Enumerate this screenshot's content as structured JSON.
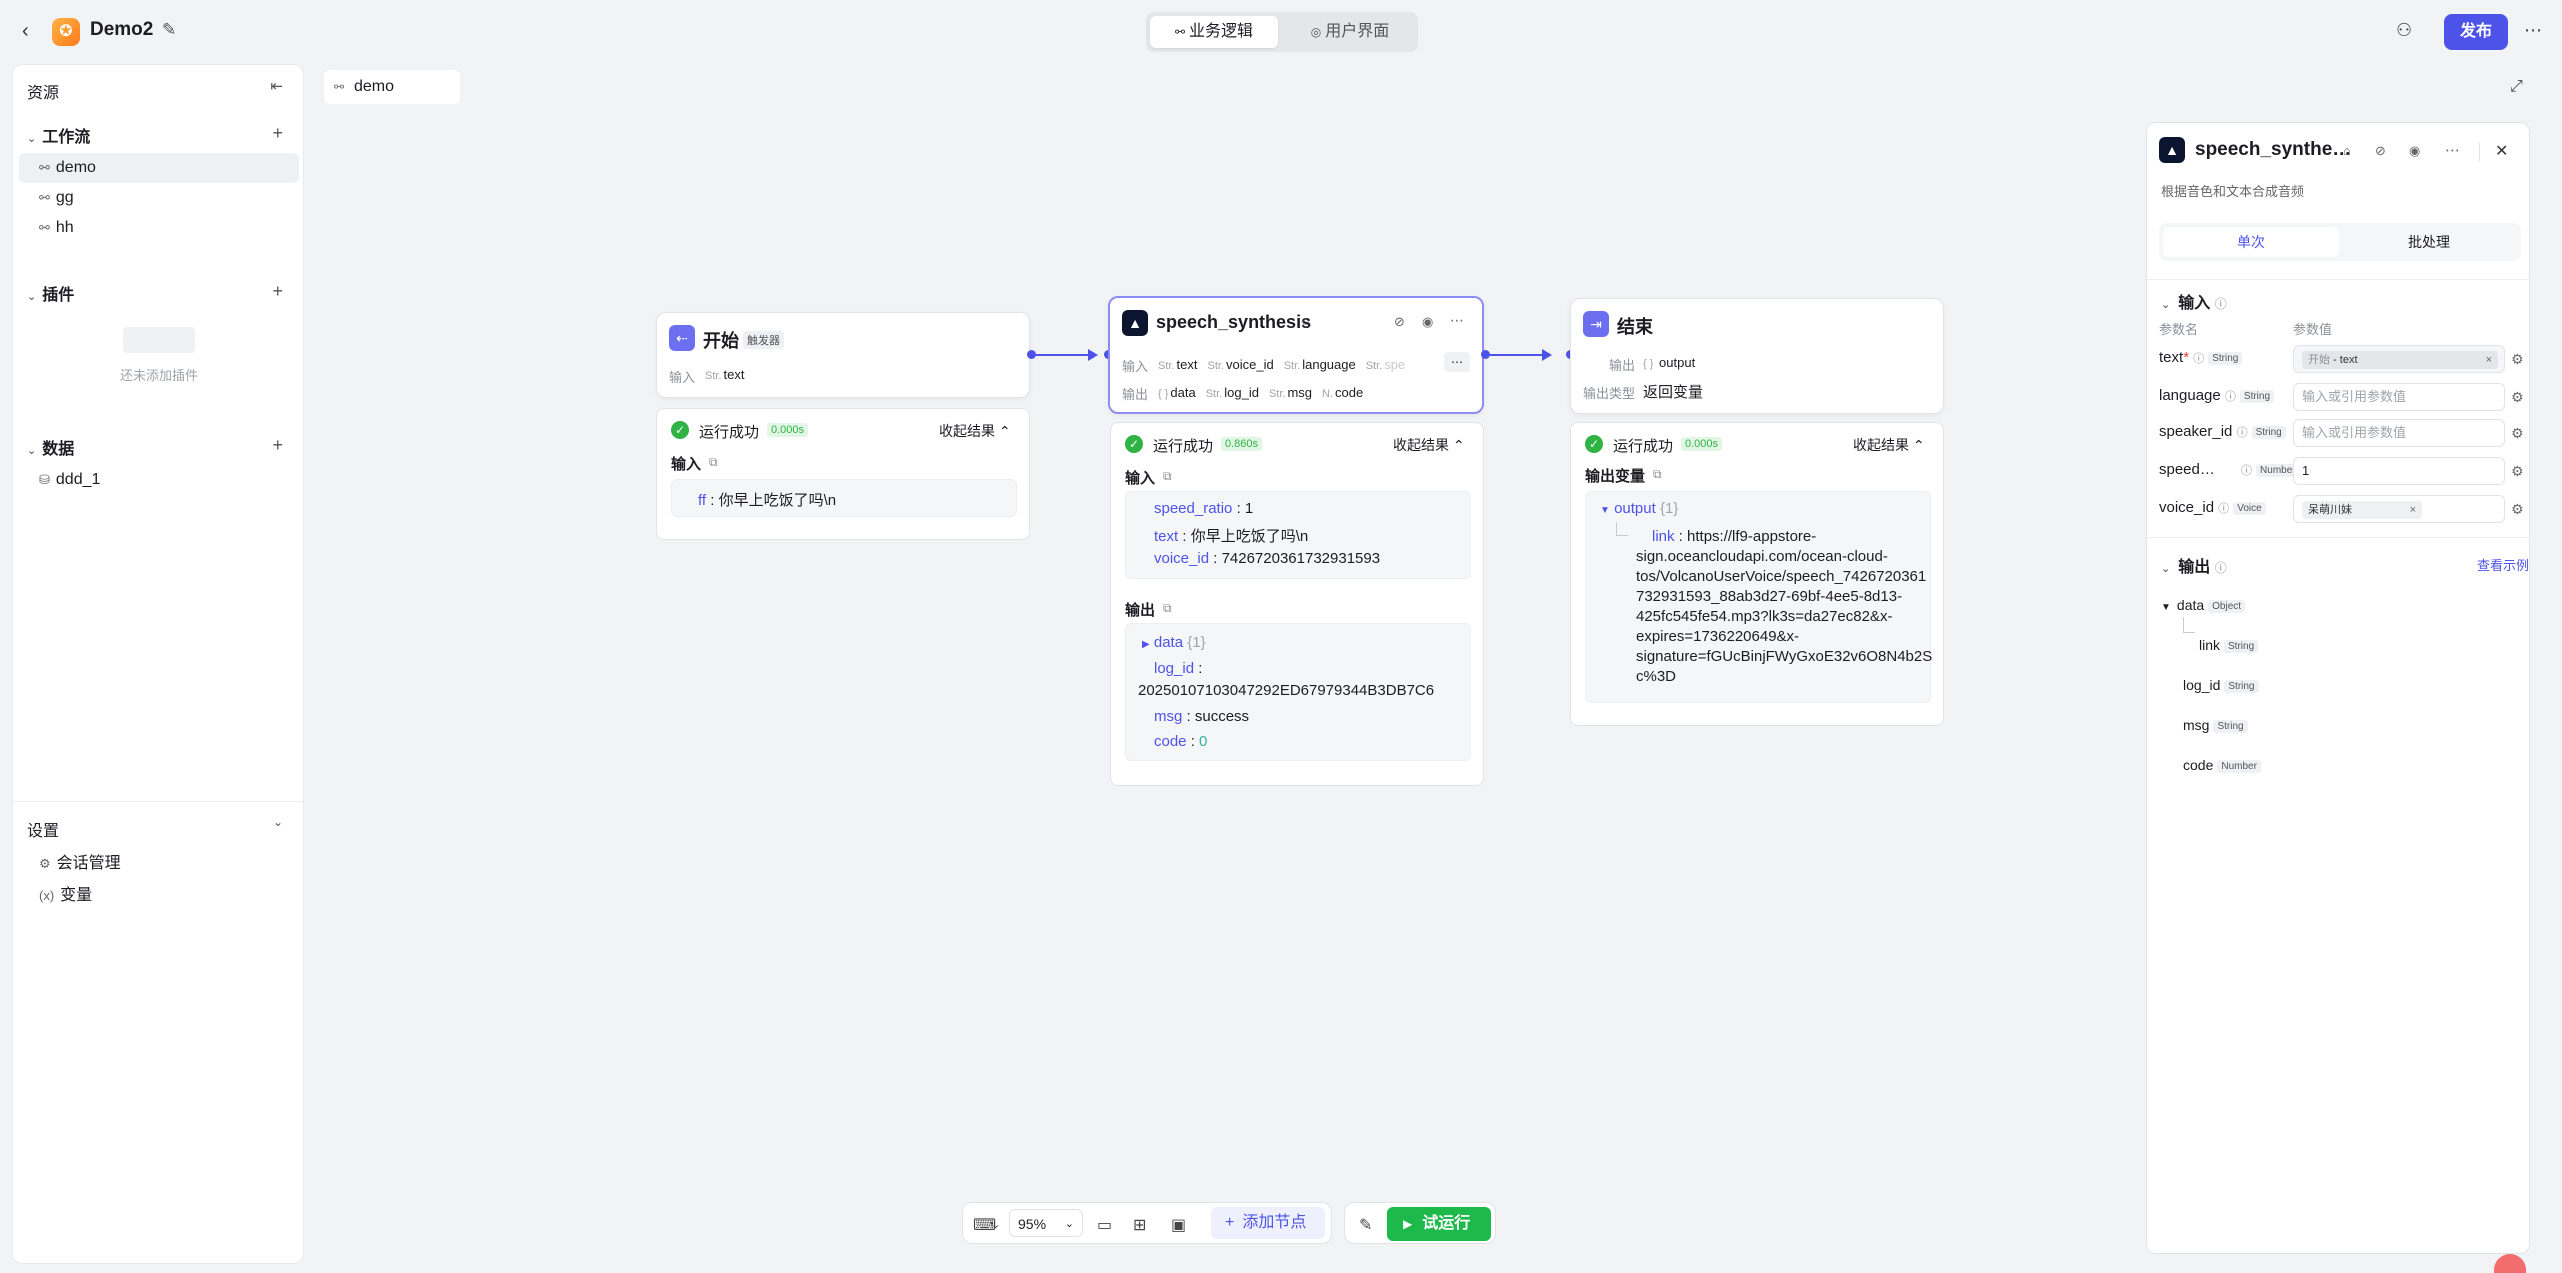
{
  "topbar": {
    "app_name": "Demo2",
    "mode_logic": "业务逻辑",
    "mode_ui": "用户界面",
    "publish": "发布"
  },
  "sidebar": {
    "title": "资源",
    "workflow_title": "工作流",
    "workflows": [
      "demo",
      "gg",
      "hh"
    ],
    "plugin_title": "插件",
    "plugin_empty": "还未添加插件",
    "data_title": "数据",
    "data_items": [
      "ddd_1"
    ],
    "settings_title": "设置",
    "settings_items": [
      "会话管理",
      "变量"
    ]
  },
  "canvas": {
    "tab": "demo",
    "zoom": "95%",
    "add_node": "添加节点",
    "run": "试运行"
  },
  "nodes": {
    "start": {
      "title": "开始",
      "badge": "触发器",
      "input_label": "输入",
      "input_type": "Str.",
      "input_name": "text",
      "result": {
        "status": "运行成功",
        "time": "0.000s",
        "collapse": "收起结果",
        "input_title": "输入",
        "input_key": "ff",
        "input_val": "你早上吃饭了吗\\n"
      }
    },
    "speech": {
      "title": "speech_synthesis",
      "input_label": "输入",
      "inputs": [
        {
          "t": "Str.",
          "n": "text"
        },
        {
          "t": "Str.",
          "n": "voice_id"
        },
        {
          "t": "Str.",
          "n": "language"
        },
        {
          "t": "Str.",
          "n": "spe"
        }
      ],
      "output_label": "输出",
      "outputs": [
        {
          "t": "{ }",
          "n": "data"
        },
        {
          "t": "Str.",
          "n": "log_id"
        },
        {
          "t": "Str.",
          "n": "msg"
        },
        {
          "t": "N.",
          "n": "code"
        }
      ],
      "result": {
        "status": "运行成功",
        "time": "0.860s",
        "collapse": "收起结果",
        "input_title": "输入",
        "in_speed_key": "speed_ratio",
        "in_speed_val": "1",
        "in_text_key": "text",
        "in_text_val": "你早上吃饭了吗\\n",
        "in_voice_key": "voice_id",
        "in_voice_val": "7426720361732931593",
        "output_title": "输出",
        "out_data_key": "data",
        "out_data_count": "{1}",
        "out_logid_key": "log_id",
        "out_logid_val": "20250107103047292ED67979344B3DB7C6",
        "out_msg_key": "msg",
        "out_msg_val": "success",
        "out_code_key": "code",
        "out_code_val": "0"
      }
    },
    "end": {
      "title": "结束",
      "output_label": "输出",
      "output_type": "{ }",
      "output_name": "output",
      "rtype_label": "输出类型",
      "rtype_val": "返回变量",
      "result": {
        "status": "运行成功",
        "time": "0.000s",
        "collapse": "收起结果",
        "var_title": "输出变量",
        "out_key": "output",
        "out_count": "{1}",
        "link_key": "link",
        "link_lines": [
          "https://lf9-appstore-",
          "sign.oceancloudapi.com/ocean-cloud-",
          "tos/VolcanoUserVoice/speech_7426720361",
          "732931593_88ab3d27-69bf-4ee5-8d13-",
          "425fc545fe54.mp3?lk3s=da27ec82&x-",
          "expires=1736220649&x-",
          "signature=fGUcBinjFWyGxoE32v6O8N4b2S",
          "c%3D"
        ]
      }
    }
  },
  "panel": {
    "title": "speech_synthe…",
    "desc": "根据音色和文本合成音频",
    "tab_single": "单次",
    "tab_batch": "批处理",
    "input_title": "输入",
    "col_name": "参数名",
    "col_value": "参数值",
    "params": [
      {
        "name": "text",
        "req": "*",
        "type": "String",
        "value_src": "开始",
        "value": "text",
        "placeholder": ""
      },
      {
        "name": "language",
        "req": "",
        "type": "String",
        "value_src": "",
        "value": "",
        "placeholder": "输入或引用参数值"
      },
      {
        "name": "speaker_id",
        "req": "",
        "type": "String",
        "value_src": "",
        "value": "",
        "placeholder": "输入或引用参数值"
      },
      {
        "name": "speed…",
        "req": "",
        "type": "Number",
        "value_src": "",
        "value": "1",
        "placeholder": ""
      },
      {
        "name": "voice_id",
        "req": "",
        "type": "Voice",
        "value_src": "",
        "value": "呆萌川妹",
        "placeholder": ""
      }
    ],
    "output_title": "输出",
    "view_example": "查看示例",
    "outputs": [
      {
        "name": "data",
        "type": "Object"
      },
      {
        "name": "link",
        "type": "String"
      },
      {
        "name": "log_id",
        "type": "String"
      },
      {
        "name": "msg",
        "type": "String"
      },
      {
        "name": "code",
        "type": "Number"
      }
    ]
  }
}
